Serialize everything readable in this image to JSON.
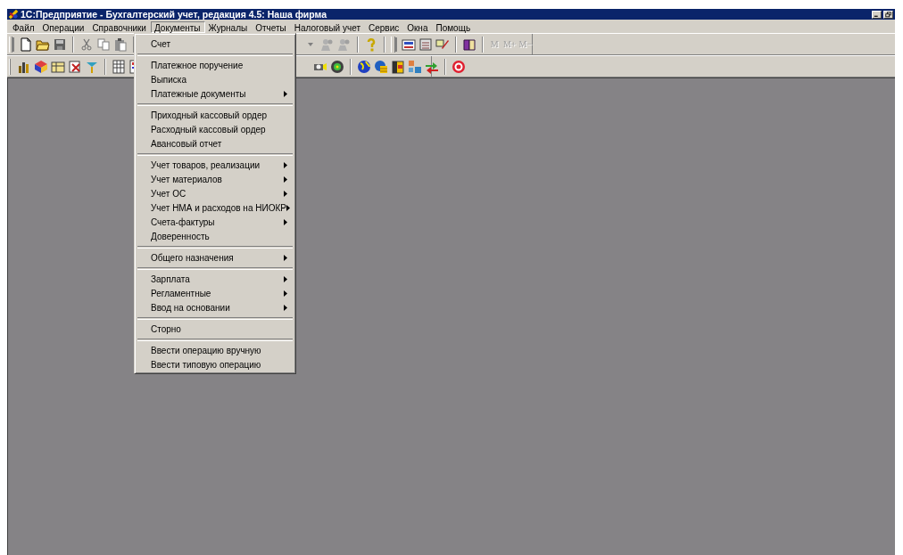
{
  "window": {
    "title": "1С:Предприятие - Бухгалтерский учет, редакция 4.5: Наша фирма"
  },
  "menu_bar": [
    {
      "label": "Файл",
      "selected": false
    },
    {
      "label": "Операции",
      "selected": false
    },
    {
      "label": "Справочники",
      "selected": false
    },
    {
      "label": "Документы",
      "selected": true
    },
    {
      "label": "Журналы",
      "selected": false
    },
    {
      "label": "Отчеты",
      "selected": false
    },
    {
      "label": "Налоговый учет",
      "selected": false
    },
    {
      "label": "Сервис",
      "selected": false
    },
    {
      "label": "Окна",
      "selected": false
    },
    {
      "label": "Помощь",
      "selected": false
    }
  ],
  "toolbar_buttons": [
    {
      "label": "M",
      "disabled": true
    },
    {
      "label": "M+",
      "disabled": true
    },
    {
      "label": "M−",
      "disabled": true
    }
  ],
  "dropdown_menu": [
    {
      "kind": "item",
      "label": "Счет",
      "submenu": false
    },
    {
      "kind": "separator"
    },
    {
      "kind": "item",
      "label": "Платежное поручение",
      "submenu": false
    },
    {
      "kind": "item",
      "label": "Выписка",
      "submenu": false
    },
    {
      "kind": "item",
      "label": "Платежные документы",
      "submenu": true
    },
    {
      "kind": "separator"
    },
    {
      "kind": "item",
      "label": "Приходный кассовый ордер",
      "submenu": false
    },
    {
      "kind": "item",
      "label": "Расходный кассовый ордер",
      "submenu": false
    },
    {
      "kind": "item",
      "label": "Авансовый отчет",
      "submenu": false
    },
    {
      "kind": "separator"
    },
    {
      "kind": "item",
      "label": "Учет товаров, реализации",
      "submenu": true
    },
    {
      "kind": "item",
      "label": "Учет материалов",
      "submenu": true
    },
    {
      "kind": "item",
      "label": "Учет ОС",
      "submenu": true
    },
    {
      "kind": "item",
      "label": "Учет НМА и расходов на НИОКР",
      "submenu": true
    },
    {
      "kind": "item",
      "label": "Счета-фактуры",
      "submenu": true
    },
    {
      "kind": "item",
      "label": "Доверенность",
      "submenu": false
    },
    {
      "kind": "separator"
    },
    {
      "kind": "item",
      "label": "Общего назначения",
      "submenu": true
    },
    {
      "kind": "separator"
    },
    {
      "kind": "item",
      "label": "Зарплата",
      "submenu": true
    },
    {
      "kind": "item",
      "label": "Регламентные",
      "submenu": true
    },
    {
      "kind": "item",
      "label": "Ввод на основании",
      "submenu": true
    },
    {
      "kind": "separator"
    },
    {
      "kind": "item",
      "label": "Сторно",
      "submenu": false
    },
    {
      "kind": "separator"
    },
    {
      "kind": "item",
      "label": "Ввести операцию вручную",
      "submenu": false
    },
    {
      "kind": "item",
      "label": "Ввести типовую операцию",
      "submenu": false
    }
  ]
}
